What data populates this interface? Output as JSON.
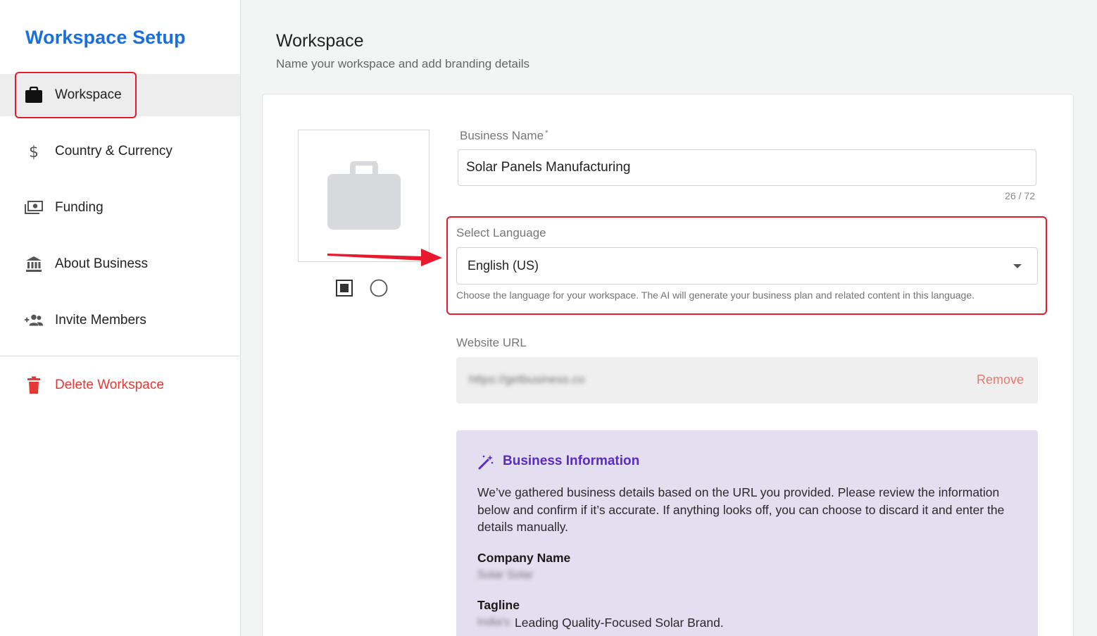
{
  "sidebar": {
    "title": "Workspace Setup",
    "items": [
      {
        "label": "Workspace",
        "icon": "briefcase-icon"
      },
      {
        "label": "Country & Currency",
        "icon": "dollar-icon"
      },
      {
        "label": "Funding",
        "icon": "money-icon"
      },
      {
        "label": "About Business",
        "icon": "bank-icon"
      },
      {
        "label": "Invite Members",
        "icon": "add-group-icon"
      }
    ],
    "delete_label": "Delete Workspace"
  },
  "header": {
    "title": "Workspace",
    "subtitle": "Name your workspace and add branding details"
  },
  "form": {
    "business_name_label": "Business Name",
    "required_mark": "*",
    "business_name_value": "Solar Panels Manufacturing",
    "business_name_counter": "26 / 72",
    "language_label": "Select Language",
    "language_value": "English (US)",
    "language_helper": "Choose the language for your workspace. The AI will generate your business plan and related content in this language.",
    "website_label": "Website URL",
    "website_value": "https://getbusiness.co",
    "remove_label": "Remove"
  },
  "business_info": {
    "title": "Business Information",
    "description": "We’ve gathered business details based on the URL you provided. Please review the information below and confirm if it’s accurate. If anything looks off, you can choose to discard it and enter the details manually.",
    "company_name_label": "Company Name",
    "company_name_value": "Solar Solar",
    "tagline_label": "Tagline",
    "tagline_prefix": "India's",
    "tagline_value": "Leading Quality-Focused Solar Brand."
  },
  "colors": {
    "accent": "#1a6fe0",
    "danger": "#e53935",
    "highlight": "#e8192c",
    "info_title": "#5b2bc4",
    "info_bg": "#e3def0"
  }
}
